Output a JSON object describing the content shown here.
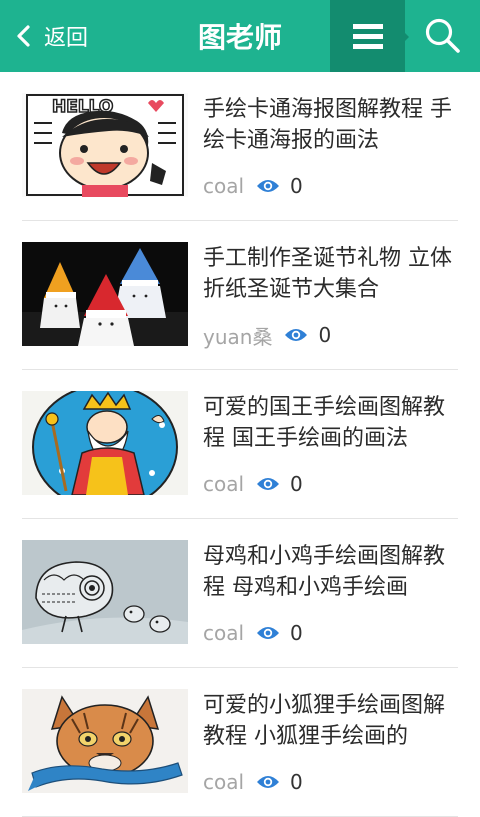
{
  "header": {
    "back_label": "返回",
    "title": "图老师",
    "accent": "#1eb390",
    "accent_dark": "#138c6f"
  },
  "articles": [
    {
      "title": "手绘卡通海报图解教程 手绘卡通海报的画法",
      "author": "coal",
      "views": "0",
      "thumb": "HELLO"
    },
    {
      "title": "手工制作圣诞节礼物 立体折纸圣诞节大集合",
      "author": "yuan桑",
      "views": "0",
      "thumb": ""
    },
    {
      "title": "可爱的国王手绘画图解教程 国王手绘画的画法",
      "author": "coal",
      "views": "0",
      "thumb": ""
    },
    {
      "title": "母鸡和小鸡手绘画图解教程 母鸡和小鸡手绘画",
      "author": "coal",
      "views": "0",
      "thumb": ""
    },
    {
      "title": "可爱的小狐狸手绘画图解教程 小狐狸手绘画的",
      "author": "coal",
      "views": "0",
      "thumb": ""
    }
  ]
}
